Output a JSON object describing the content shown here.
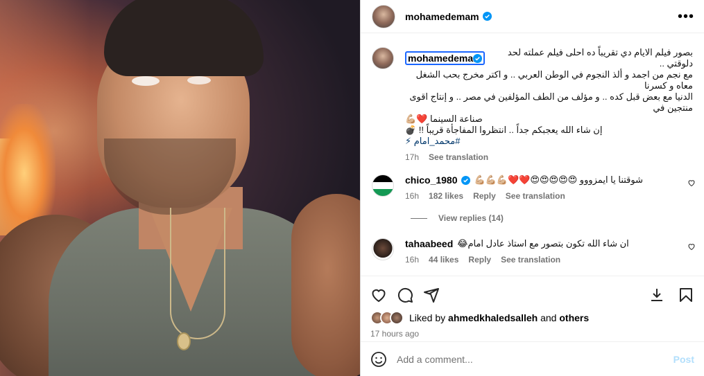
{
  "post": {
    "username": "mohamedemam",
    "more_icon": "more-horizontal-icon",
    "caption": {
      "username": "mohamedemam",
      "lines": [
        "بصور فيلم الايام دي تقريباً ده احلى فيلم عملته لحد دلوقتي ..",
        "مع نجم من اجمد و ألذ النجوم في الوطن العربي .. و اكتر مخرج بحب الشغل معاه و كسرنا",
        "الدنيا مع بعض قبل كده .. و مؤلف من الطف المؤلفين في مصر .. و إنتاج اقوى منتجين في",
        "صناعة السينما ❤️💪🏼",
        "إن شاء الله يعجبكم جداً .. انتظروا المفاجأة قريباً !! 💣",
        "#محمد_امام ⚡"
      ],
      "time": "17h",
      "see_translation": "See translation"
    },
    "comments": [
      {
        "username": "chico_1980",
        "verified": true,
        "text": "شوقتنا يا ايمزووو 😍😍😍😍😍❤️❤️💪🏼💪🏼💪🏼",
        "time": "16h",
        "likes": "182 likes",
        "reply": "Reply",
        "see_translation": "See translation"
      },
      {
        "username": "tahaabeed",
        "verified": false,
        "text": "ان شاء الله تكون بتصور مع استاذ عادل امام😂",
        "time": "16h",
        "likes": "44 likes",
        "reply": "Reply",
        "see_translation": "See translation"
      }
    ],
    "view_replies": "View replies (14)",
    "liked_by_prefix": "Liked by",
    "liked_by_user": "ahmedkhaledsalleh",
    "liked_by_and": "and",
    "liked_by_others": "others",
    "posted_time": "17 hours ago",
    "comment_placeholder": "Add a comment...",
    "post_button": "Post"
  },
  "colors": {
    "verified": "#0095f6",
    "link": "#00376b",
    "muted": "#737373",
    "highlight": "#1a66ff"
  }
}
